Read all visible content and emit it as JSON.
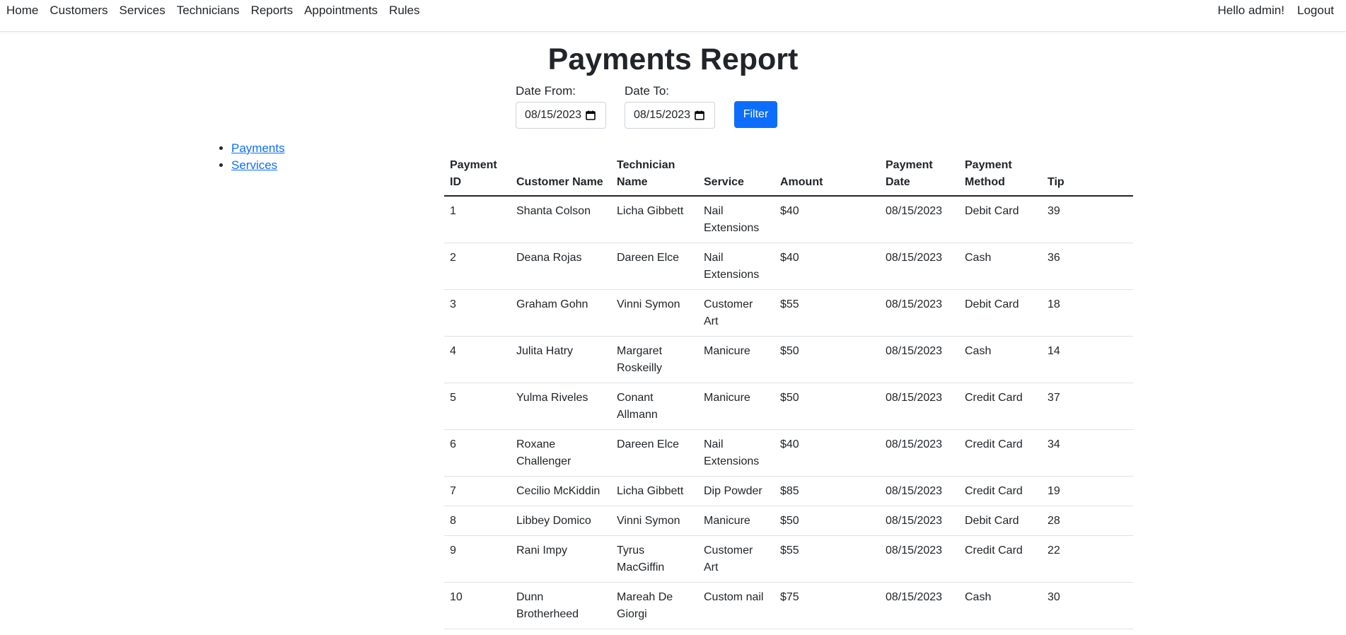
{
  "nav": {
    "left": [
      "Home",
      "Customers",
      "Services",
      "Technicians",
      "Reports",
      "Appointments",
      "Rules"
    ],
    "greeting": "Hello admin!",
    "logout": "Logout"
  },
  "page": {
    "title": "Payments Report"
  },
  "filter": {
    "from_label": "Date From:",
    "from_value": "08/15/2023",
    "to_label": "Date To:",
    "to_value": "08/15/2023",
    "button": "Filter"
  },
  "sidebar": {
    "links": [
      "Payments",
      "Services"
    ]
  },
  "table": {
    "headers": [
      "Payment ID",
      "Customer Name",
      "Technician Name",
      "Service",
      "Amount",
      "Payment Date",
      "Payment Method",
      "Tip"
    ],
    "rows": [
      [
        "1",
        "Shanta Colson",
        "Licha Gibbett",
        "Nail Extensions",
        "$40",
        "08/15/2023",
        "Debit Card",
        "39"
      ],
      [
        "2",
        "Deana Rojas",
        "Dareen Elce",
        "Nail Extensions",
        "$40",
        "08/15/2023",
        "Cash",
        "36"
      ],
      [
        "3",
        "Graham Gohn",
        "Vinni Symon",
        "Customer Art",
        "$55",
        "08/15/2023",
        "Debit Card",
        "18"
      ],
      [
        "4",
        "Julita Hatry",
        "Margaret Roskeilly",
        "Manicure",
        "$50",
        "08/15/2023",
        "Cash",
        "14"
      ],
      [
        "5",
        "Yulma Riveles",
        "Conant Allmann",
        "Manicure",
        "$50",
        "08/15/2023",
        "Credit Card",
        "37"
      ],
      [
        "6",
        "Roxane Challenger",
        "Dareen Elce",
        "Nail Extensions",
        "$40",
        "08/15/2023",
        "Credit Card",
        "34"
      ],
      [
        "7",
        "Cecilio McKiddin",
        "Licha Gibbett",
        "Dip Powder",
        "$85",
        "08/15/2023",
        "Credit Card",
        "19"
      ],
      [
        "8",
        "Libbey Domico",
        "Vinni Symon",
        "Manicure",
        "$50",
        "08/15/2023",
        "Debit Card",
        "28"
      ],
      [
        "9",
        "Rani Impy",
        "Tyrus MacGiffin",
        "Customer Art",
        "$55",
        "08/15/2023",
        "Credit Card",
        "22"
      ],
      [
        "10",
        "Dunn Brotherheed",
        "Mareah De Giorgi",
        "Custom nail",
        "$75",
        "08/15/2023",
        "Cash",
        "30"
      ]
    ]
  }
}
